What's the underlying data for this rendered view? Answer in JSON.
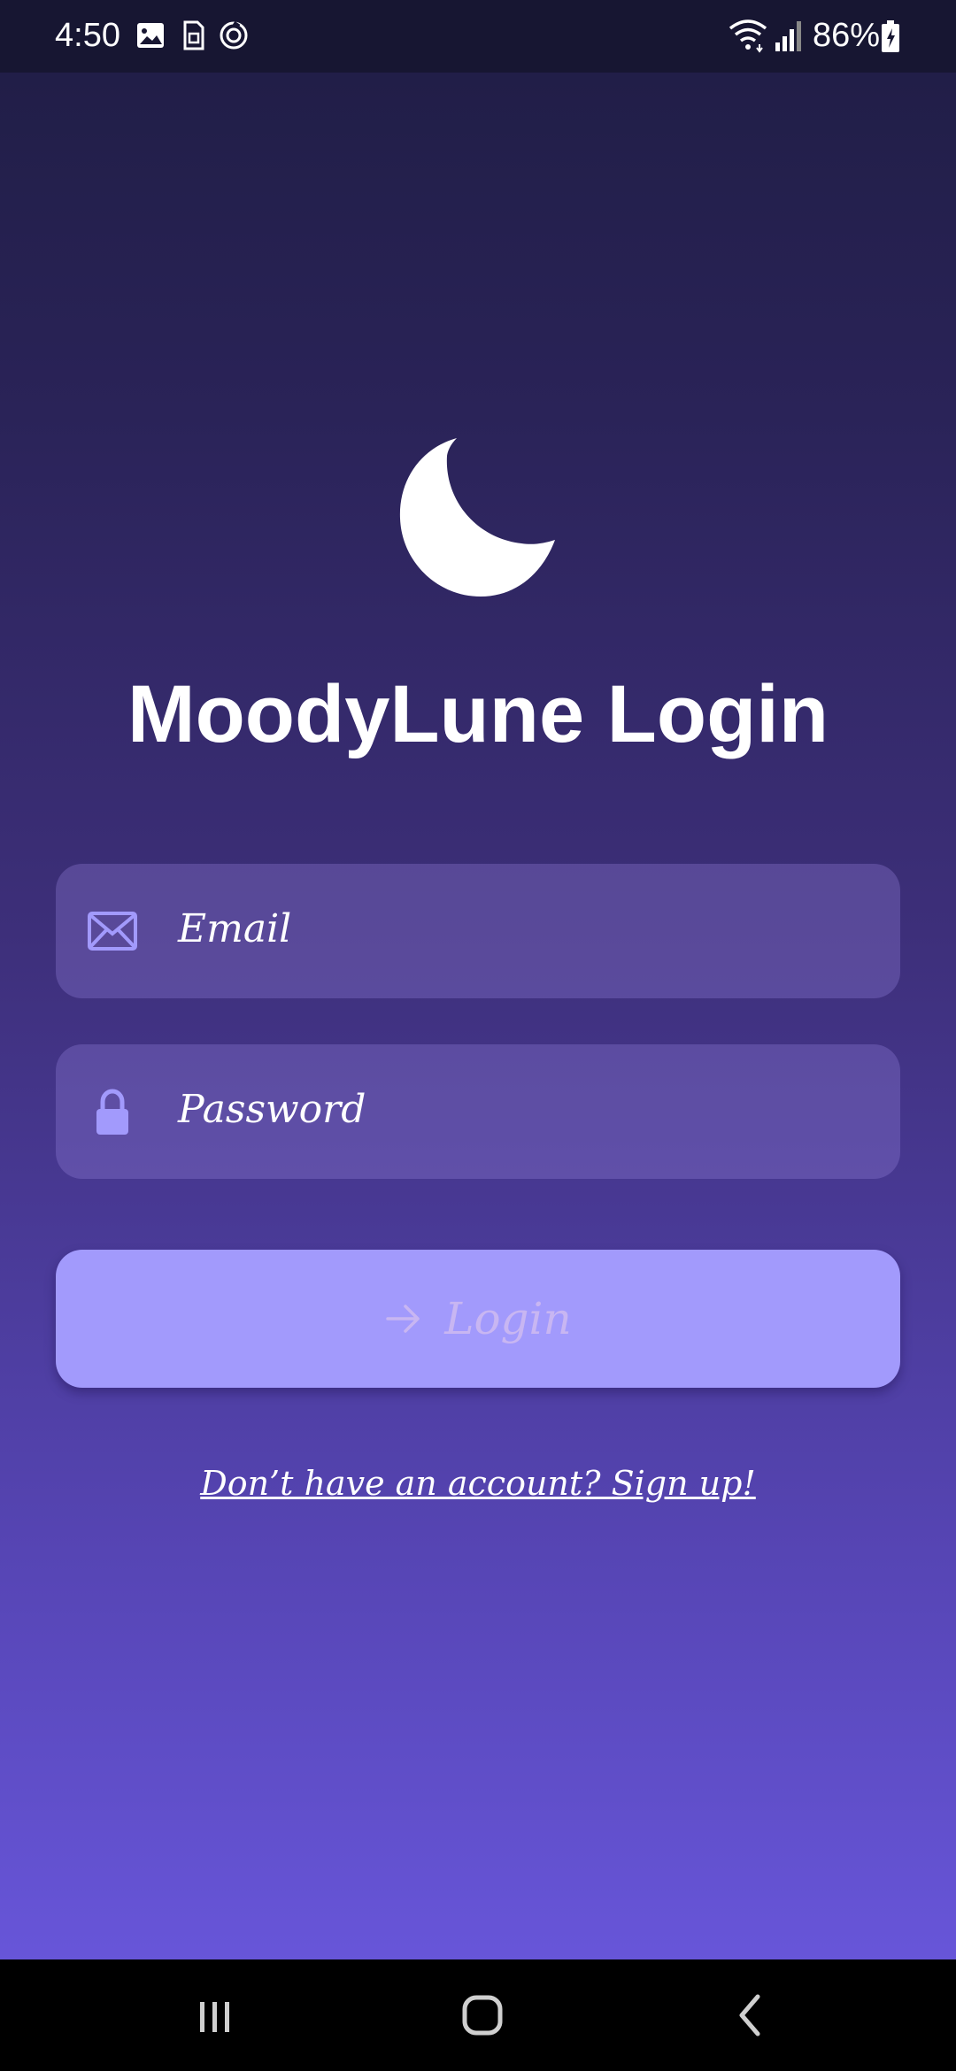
{
  "status_bar": {
    "time": "4:50",
    "battery": "86%",
    "icons": [
      "image-icon",
      "sim-icon",
      "sync-icon",
      "wifi-icon",
      "signal-icon",
      "battery-charging-icon"
    ]
  },
  "logo": {
    "icon": "moon-icon"
  },
  "title": "MoodyLune Login",
  "email_field": {
    "placeholder": "Email",
    "icon": "mail-icon"
  },
  "password_field": {
    "placeholder": "Password",
    "icon": "lock-icon"
  },
  "login_button": {
    "label": "Login",
    "icon": "arrow-right-icon",
    "color": "#a29afc"
  },
  "signup_link": "Don’t have an account? Sign up!",
  "colors": {
    "background_top": "#1f1d44",
    "background_bottom": "#6c5ae3",
    "field_icon": "#a29afc"
  },
  "nav_bar": {
    "buttons": [
      "recents-button",
      "home-button",
      "back-button"
    ]
  }
}
